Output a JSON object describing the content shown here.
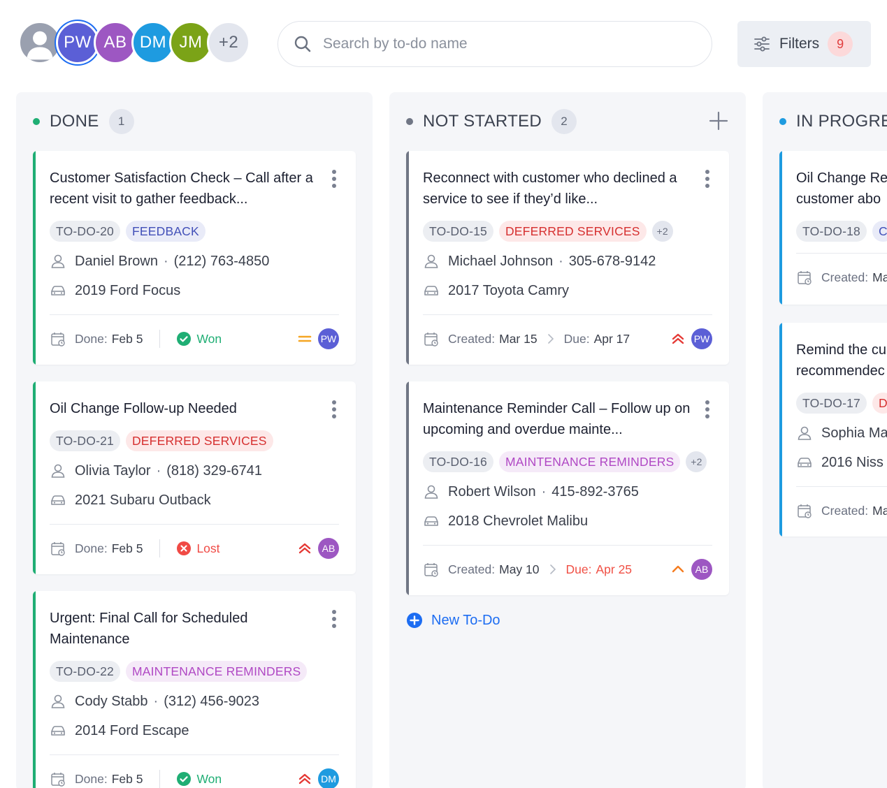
{
  "users": {
    "avatars": [
      {
        "initials": "",
        "color": "#9aa0af",
        "kind": "photo"
      },
      {
        "initials": "PW",
        "color": "#5b5fd6",
        "kind": "initials"
      },
      {
        "initials": "AB",
        "color": "#9d57c2",
        "kind": "initials"
      },
      {
        "initials": "DM",
        "color": "#1e9be0",
        "kind": "initials"
      },
      {
        "initials": "JM",
        "color": "#7ba317",
        "kind": "initials"
      }
    ],
    "more": "+2"
  },
  "search": {
    "placeholder": "Search by to-do name",
    "value": ""
  },
  "filters": {
    "label": "Filters",
    "count": "9"
  },
  "colors": {
    "done": "#1fae74",
    "not_started": "#707685",
    "in_progress": "#1e9be0",
    "link": "#1d6df2",
    "lost": "#f04a45",
    "won": "#1fae74"
  },
  "columns": {
    "done": {
      "title": "DONE",
      "count": "1",
      "cards": [
        {
          "title": "Customer Satisfaction Check – Call after a recent visit to gather feedback...",
          "id": "TO-DO-20",
          "tag": "FEEDBACK",
          "name": "Daniel Brown",
          "phone": "(212) 763-4850",
          "car": "2019 Ford Focus",
          "date_label": "Done:",
          "date": "Feb 5",
          "result": "Won",
          "priority": "medium-icon",
          "assignee": "PW"
        },
        {
          "title": "Oil Change Follow-up Needed",
          "id": "TO-DO-21",
          "tag": "DEFERRED SERVICES",
          "name": "Olivia Taylor",
          "phone": "(818) 329-6741",
          "car": "2021 Subaru Outback",
          "date_label": "Done:",
          "date": "Feb 5",
          "result": "Lost",
          "priority": "highest-icon",
          "assignee": "AB"
        },
        {
          "title": "Urgent: Final Call for Scheduled Maintenance",
          "id": "TO-DO-22",
          "tag": "MAINTENANCE REMINDERS",
          "name": "Cody Stabb",
          "phone": "(312) 456-9023",
          "car": "2014 Ford Escape",
          "date_label": "Done:",
          "date": "Feb 5",
          "result": "Won",
          "priority": "highest-icon",
          "assignee": "DM"
        }
      ]
    },
    "not_started": {
      "title": "NOT STARTED",
      "count": "2",
      "cards": [
        {
          "title": "Reconnect with customer who declined a service to see if they’d like...",
          "id": "TO-DO-15",
          "tag": "DEFERRED SERVICES",
          "extra": "+2",
          "name": "Michael Johnson",
          "phone": "305-678-9142",
          "car": "2017 Toyota Camry",
          "created_label": "Created:",
          "created": "Mar 15",
          "due_label": "Due:",
          "due": "Apr 17",
          "priority": "highest-icon",
          "assignee": "PW"
        },
        {
          "title": "Maintenance Reminder Call – Follow up on upcoming and overdue mainte...",
          "id": "TO-DO-16",
          "tag": "MAINTENANCE REMINDERS",
          "extra": "+2",
          "name": "Robert Wilson",
          "phone": "415-892-3765",
          "car": "2018 Chevrolet Malibu",
          "created_label": "Created:",
          "created": "May 10",
          "due_label": "Due:",
          "due": "Apr 25",
          "priority": "high-icon",
          "assignee": "AB"
        }
      ],
      "new_todo": "New To-Do"
    },
    "in_progress": {
      "title": "IN PROGRES",
      "cards": [
        {
          "title_line1": "Oil Change Re",
          "title_line2": "customer abo",
          "id": "TO-DO-18",
          "tag": "C",
          "created_label": "Created:",
          "created": "Ma"
        },
        {
          "title_line1": "Remind the cu",
          "title_line2": "recommendec",
          "id": "TO-DO-17",
          "tag": "D",
          "name": "Sophia Ma",
          "car": "2016 Niss",
          "created_label": "Created:",
          "created": "Ma"
        }
      ]
    }
  }
}
